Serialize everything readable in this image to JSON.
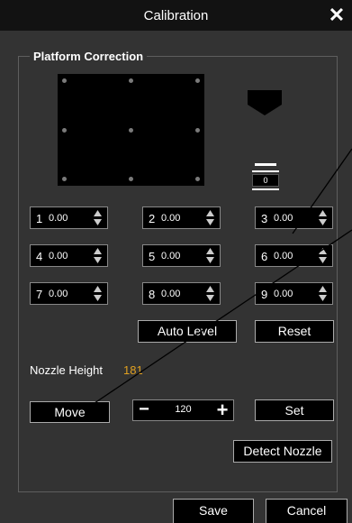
{
  "window": {
    "title": "Calibration",
    "close_glyph": "✕"
  },
  "group": {
    "label": "Platform Correction"
  },
  "offset_indicator": {
    "value": "0"
  },
  "points": [
    {
      "index": "1",
      "value": "0.00"
    },
    {
      "index": "2",
      "value": "0.00"
    },
    {
      "index": "3",
      "value": "0.00"
    },
    {
      "index": "4",
      "value": "0.00"
    },
    {
      "index": "5",
      "value": "0.00"
    },
    {
      "index": "6",
      "value": "0.00"
    },
    {
      "index": "7",
      "value": "0.00"
    },
    {
      "index": "8",
      "value": "0.00"
    },
    {
      "index": "9",
      "value": "0.00"
    }
  ],
  "buttons": {
    "auto_level": "Auto Level",
    "reset": "Reset",
    "move": "Move",
    "set": "Set",
    "detect_nozzle": "Detect Nozzle",
    "save": "Save",
    "cancel": "Cancel"
  },
  "nozzle": {
    "label": "Nozzle Height",
    "value": "181"
  },
  "stepper": {
    "minus": "−",
    "value": "120",
    "plus": "+"
  },
  "colors": {
    "accent": "#e0a020",
    "panel": "#333333",
    "title_bar": "#121212"
  }
}
